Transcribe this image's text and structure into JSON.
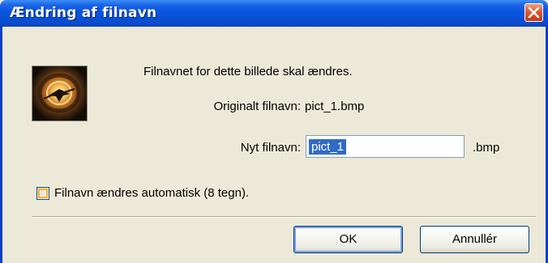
{
  "window": {
    "title": "Ændring af filnavn"
  },
  "dialog": {
    "message": "Filnavnet for dette billede skal ændres.",
    "original_label": "Originalt filnavn:",
    "original_value": "pict_1.bmp",
    "new_label": "Nyt filnavn:",
    "new_value": "pict_1",
    "extension": ".bmp",
    "checkbox_label": "Filnavn ændres automatisk (8 tegn).",
    "checkbox_checked": false
  },
  "buttons": {
    "ok_label": "OK",
    "cancel_label": "Annullér"
  },
  "icons": {
    "close": "close-icon",
    "image": "image-thumbnail-icon"
  },
  "colors": {
    "titlebar": "#0a56e0",
    "close_button": "#d24a22",
    "dialog_background": "#ece9d8",
    "selection": "#316ac5",
    "checkbox_accent": "#f8b33a"
  }
}
